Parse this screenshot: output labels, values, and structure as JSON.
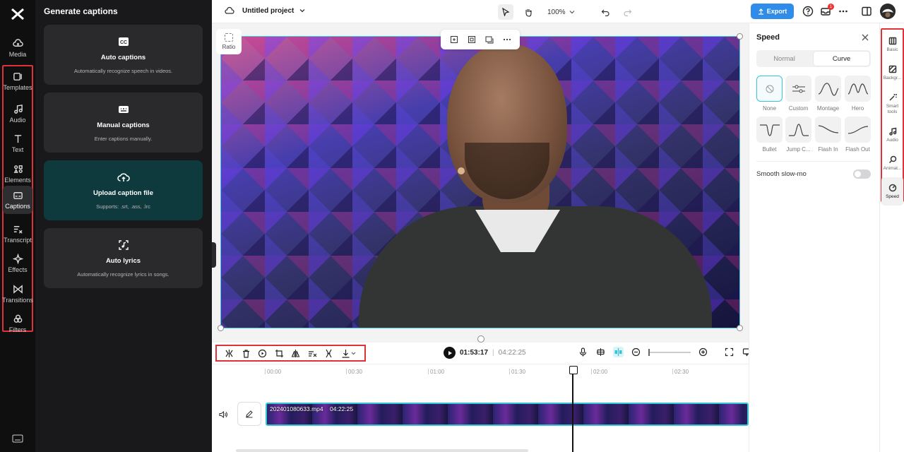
{
  "left_rail": {
    "items": [
      {
        "label": "Media",
        "icon": "cloud-upload-icon"
      },
      {
        "label": "Templates",
        "icon": "templates-icon"
      },
      {
        "label": "Audio",
        "icon": "music-note-icon"
      },
      {
        "label": "Text",
        "icon": "text-icon"
      },
      {
        "label": "Elements",
        "icon": "elements-icon"
      },
      {
        "label": "Captions",
        "icon": "captions-icon",
        "active": true
      },
      {
        "label": "Transcript",
        "icon": "transcript-icon"
      },
      {
        "label": "Effects",
        "icon": "effects-icon"
      },
      {
        "label": "Transitions",
        "icon": "transitions-icon"
      },
      {
        "label": "Filters",
        "icon": "filters-icon"
      }
    ]
  },
  "captions_panel": {
    "title": "Generate captions",
    "cards": [
      {
        "title": "Auto captions",
        "subtitle": "Automatically recognize speech in videos."
      },
      {
        "title": "Manual captions",
        "subtitle": "Enter captions manually."
      },
      {
        "title": "Upload caption file",
        "subtitle": "Supports: .srt, .ass, .lrc"
      },
      {
        "title": "Auto lyrics",
        "subtitle": "Automatically recognize lyrics in songs."
      }
    ]
  },
  "topbar": {
    "project_name": "Untitled project",
    "zoom": "100%",
    "export_label": "Export",
    "notification_count": "1"
  },
  "stage": {
    "ratio_label": "Ratio"
  },
  "playback": {
    "current_time": "01:53:17",
    "separator": "|",
    "total_time": "04:22:25"
  },
  "timeline": {
    "ticks": [
      "00:00",
      "00:30",
      "01:00",
      "01:30",
      "02:00",
      "02:30"
    ],
    "clip_name": "202401080633.mp4",
    "clip_duration": "04:22:25"
  },
  "speed_panel": {
    "title": "Speed",
    "tabs": [
      {
        "label": "Normal",
        "active": false
      },
      {
        "label": "Curve",
        "active": true
      }
    ],
    "curves": [
      {
        "label": "None",
        "selected": true
      },
      {
        "label": "Custom"
      },
      {
        "label": "Montage"
      },
      {
        "label": "Hero"
      },
      {
        "label": "Bullet"
      },
      {
        "label": "Jump C..."
      },
      {
        "label": "Flash In"
      },
      {
        "label": "Flash Out"
      }
    ],
    "smooth_label": "Smooth slow-mo",
    "smooth_on": false
  },
  "right_rail": {
    "items": [
      {
        "label": "Basic"
      },
      {
        "label": "Backgr..."
      },
      {
        "label": "Smart tools"
      },
      {
        "label": "Audio"
      },
      {
        "label": "Animat..."
      },
      {
        "label": "Speed",
        "active": true
      }
    ]
  },
  "colors": {
    "accent": "#39c4d6",
    "export": "#2f8ce8",
    "highlight_box": "#e0303a"
  }
}
